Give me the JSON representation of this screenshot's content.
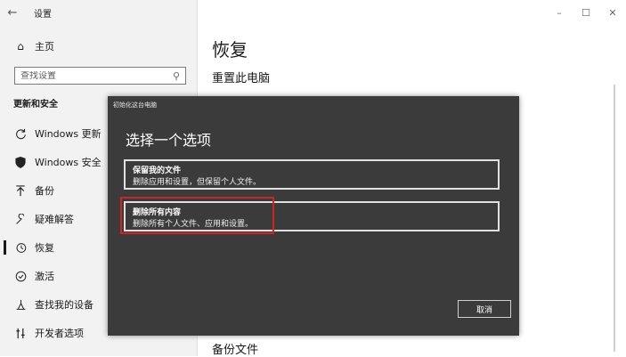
{
  "window": {
    "title": "设置"
  },
  "window_controls": {
    "minimize": "–",
    "maximize": "☐",
    "close": "✕"
  },
  "sidebar": {
    "home_label": "主页",
    "search_placeholder": "查找设置",
    "section_title": "更新和安全",
    "items": [
      {
        "label": "Windows 更新",
        "icon": "sync-icon"
      },
      {
        "label": "Windows 安全",
        "icon": "shield-icon"
      },
      {
        "label": "备份",
        "icon": "backup-arrow-icon"
      },
      {
        "label": "疑难解答",
        "icon": "wrench-icon"
      },
      {
        "label": "恢复",
        "icon": "history-icon",
        "active": true
      },
      {
        "label": "激活",
        "icon": "check-circle-icon"
      },
      {
        "label": "查找我的设备",
        "icon": "find-device-icon"
      },
      {
        "label": "开发者选项",
        "icon": "developer-icon"
      }
    ]
  },
  "content": {
    "title": "恢复",
    "subtitle": "重置此电脑",
    "bottom_heading": "备份文件"
  },
  "dialog": {
    "title": "初始化这台电脑",
    "heading": "选择一个选项",
    "options": [
      {
        "title": "保留我的文件",
        "desc": "删除应用和设置，但保留个人文件。"
      },
      {
        "title": "删除所有内容",
        "desc": "删除所有个人文件、应用和设置。"
      }
    ],
    "cancel_label": "取消"
  },
  "colors": {
    "highlight": "#d02424",
    "dialog_bg": "#3b3b3b",
    "sidebar_bg": "#f2f2f2"
  }
}
